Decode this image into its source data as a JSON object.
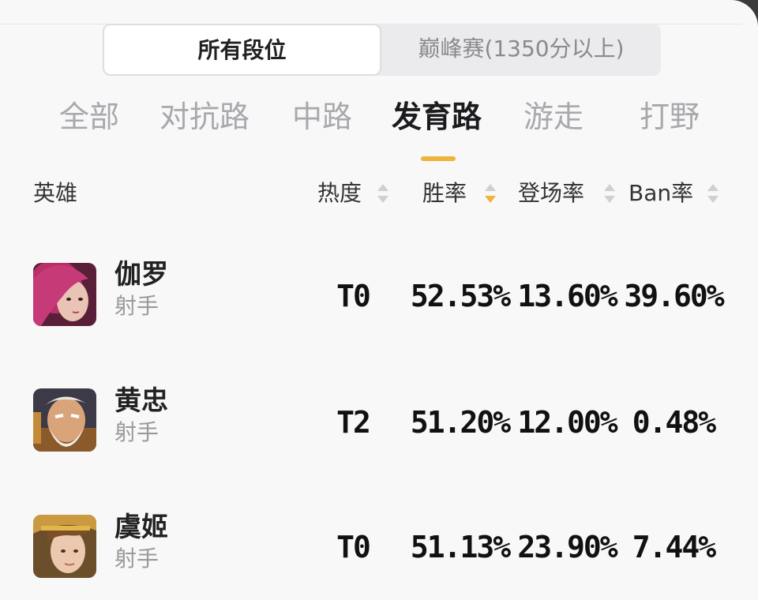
{
  "rank_filter": {
    "options": [
      "所有段位",
      "巅峰赛(1350分以上)"
    ],
    "selected": "所有段位"
  },
  "lane_tabs": {
    "items": [
      "全部",
      "对抗路",
      "中路",
      "发育路",
      "游走",
      "打野"
    ],
    "active": "发育路"
  },
  "colors": {
    "accent": "#f0b33b",
    "panel_bg": "#f8f8f9",
    "text_primary": "#1c1c1e",
    "text_muted": "#a8a8ad"
  },
  "table": {
    "headers": {
      "hero": "英雄",
      "heat": "热度",
      "win_rate": "胜率",
      "appearance_rate": "登场率",
      "ban_rate": "Ban率"
    },
    "sorted_by": "胜率",
    "sort_direction": "descending",
    "rows": [
      {
        "name": "伽罗",
        "role": "射手",
        "tier": "T0",
        "win_rate": "52.53%",
        "appearance_rate": "13.60%",
        "ban_rate": "39.60%",
        "avatar_icon": "hero-portrait-icon"
      },
      {
        "name": "黄忠",
        "role": "射手",
        "tier": "T2",
        "win_rate": "51.20%",
        "appearance_rate": "12.00%",
        "ban_rate": "0.48%",
        "avatar_icon": "hero-portrait-icon"
      },
      {
        "name": "虞姬",
        "role": "射手",
        "tier": "T0",
        "win_rate": "51.13%",
        "appearance_rate": "23.90%",
        "ban_rate": "7.44%",
        "avatar_icon": "hero-portrait-icon"
      }
    ]
  }
}
